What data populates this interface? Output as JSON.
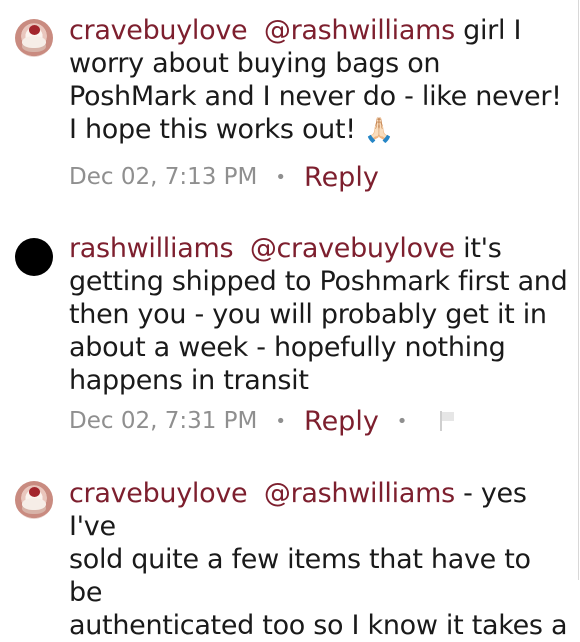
{
  "comments": [
    {
      "username": "cravebuylove",
      "mention": "@rashwilliams",
      "text_lines": [
        "girl I",
        "worry about buying bags on",
        "PoshMark and I never do - like never!",
        "I hope this works out!"
      ],
      "emoji": "🙏🏻",
      "timestamp": "Dec 02, 7:13 PM",
      "reply_label": "Reply"
    },
    {
      "username": "rashwilliams",
      "mention": "@cravebuylove",
      "text_lines": [
        "it's",
        "getting shipped to Poshmark first and",
        "then you - you will probably get it in",
        "about a week - hopefully nothing",
        "happens in transit"
      ],
      "timestamp": "Dec 02, 7:31 PM",
      "reply_label": "Reply",
      "flag_icon": "flag-icon"
    },
    {
      "username": "cravebuylove",
      "mention": "@rashwilliams",
      "text_lines": [
        "- yes I've",
        "sold quite a few items that have to be",
        "authenticated too so I know it takes a"
      ]
    }
  ],
  "separator": "•",
  "colors": {
    "accent": "#7d1f2e",
    "meta_gray": "#8f8f8f",
    "text": "#1a1a1a"
  }
}
